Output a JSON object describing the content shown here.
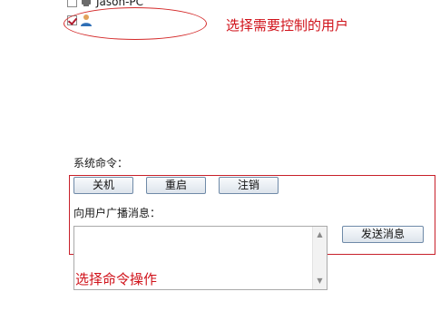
{
  "user_tree": {
    "items": [
      {
        "name": "Jason-PC",
        "checked": false
      },
      {
        "name": "",
        "checked": true
      }
    ]
  },
  "annotations": {
    "select_users": "选择需要控制的用户",
    "select_command": "选择命令操作"
  },
  "system_commands": {
    "label": "系统命令：",
    "shutdown": "关机",
    "restart": "重启",
    "logoff": "注销"
  },
  "broadcast": {
    "label": "向用户广播消息：",
    "message_value": "",
    "send_label": "发送消息"
  },
  "colors": {
    "annotation_red": "#d0121a",
    "button_border": "#6f8aa8"
  }
}
